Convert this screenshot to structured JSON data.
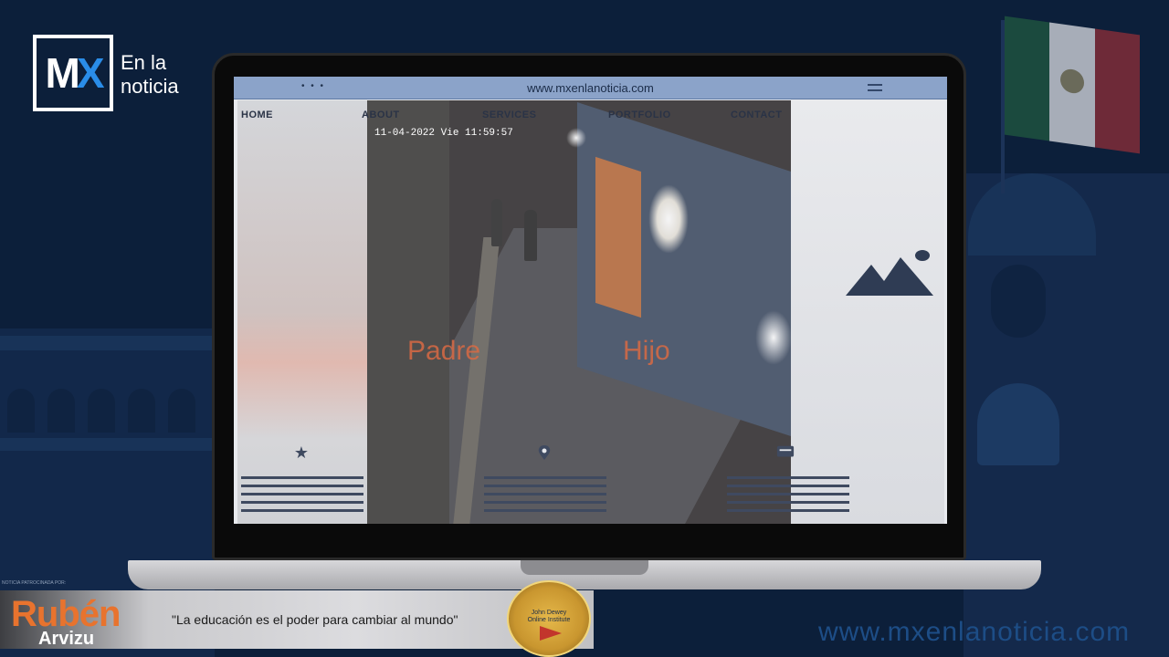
{
  "logo": {
    "mark_letters": [
      "M",
      "X"
    ],
    "text_line1": "En la",
    "text_line2": "noticia"
  },
  "browser": {
    "url": "www.mxenlanoticia.com",
    "dots": "• • •"
  },
  "site_nav": {
    "items": [
      "HOME",
      "ABOUT",
      "SERVICES",
      "PORTFOLIO",
      "CONTACT"
    ]
  },
  "video": {
    "timestamp": "11-04-2022 Vie 11:59:57",
    "label_left": "Padre",
    "label_right": "Hijo"
  },
  "icons": {
    "star": "star-icon",
    "pin": "location-pin-icon",
    "chat": "chat-icon",
    "mountain": "image-placeholder-icon"
  },
  "banner": {
    "caption": "NOTICIA PATROCINADA POR:",
    "name": "Rubén",
    "surname": "Arvizu",
    "quote": "\"La educación es el poder para cambiar al mundo\"",
    "badge_line1": "John Dewey",
    "badge_line2": "Online Institute"
  },
  "watermark": "www.mxenlanoticia.com",
  "colors": {
    "background": "#0c1f3a",
    "brand_blue": "#2a8de8",
    "banner_orange": "#e8732e",
    "video_label": "#d96a44"
  }
}
